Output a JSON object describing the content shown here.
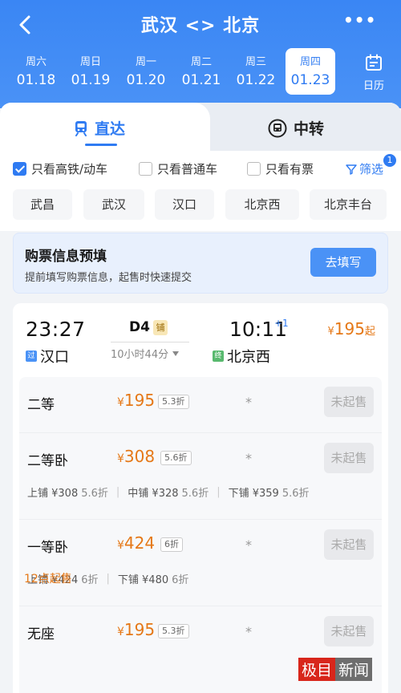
{
  "header": {
    "title": "武汉 <> 北京",
    "dates": [
      {
        "weekday": "周六",
        "date": "01.18"
      },
      {
        "weekday": "周日",
        "date": "01.19"
      },
      {
        "weekday": "周一",
        "date": "01.20"
      },
      {
        "weekday": "周二",
        "date": "01.21"
      },
      {
        "weekday": "周三",
        "date": "01.22"
      },
      {
        "weekday": "周四",
        "date": "01.23"
      }
    ],
    "calendar_label": "日历"
  },
  "tabs": {
    "direct": "直达",
    "transfer": "中转"
  },
  "filters": {
    "hs_only": "只看高铁/动车",
    "normal_only": "只看普通车",
    "available_only": "只看有票",
    "filter_label": "筛选",
    "filter_count": "1"
  },
  "stations": [
    "武昌",
    "武汉",
    "汉口",
    "北京西",
    "北京丰台"
  ],
  "prefill": {
    "title": "购票信息预填",
    "subtitle": "提前填写购票信息，起售时快速提交",
    "button": "去填写"
  },
  "train": {
    "dep_time": "23:27",
    "arr_time": "10:11",
    "plus_day": "+1",
    "number": "D4",
    "sleeper_tag": "铺",
    "duration": "10小时44分",
    "from_tag": "过",
    "from": "汉口",
    "to_tag": "终",
    "to": "北京西",
    "min_price_yen": "¥",
    "min_price": "195",
    "min_price_suffix": "起",
    "seats": [
      {
        "name": "二等",
        "yen": "¥",
        "price": "195",
        "discount": "5.3折",
        "availability": "*",
        "status": "未起售"
      },
      {
        "name": "二等卧",
        "yen": "¥",
        "price": "308",
        "discount": "5.6折",
        "availability": "*",
        "status": "未起售",
        "berths": [
          {
            "label": "上铺 ¥308",
            "disc": "5.6折"
          },
          {
            "label": "中铺 ¥328",
            "disc": "5.6折"
          },
          {
            "label": "下铺 ¥359",
            "disc": "5.6折"
          }
        ]
      },
      {
        "name": "一等卧",
        "yen": "¥",
        "price": "424",
        "discount": "6折",
        "availability": "*",
        "status": "未起售",
        "berths": [
          {
            "label": "上铺 ¥424",
            "disc": "6折"
          },
          {
            "label": "下铺 ¥480",
            "disc": "6折"
          }
        ]
      },
      {
        "name": "无座",
        "yen": "¥",
        "price": "195",
        "discount": "5.3折",
        "availability": "*",
        "status": "未起售"
      }
    ],
    "sale_time": "12点起售"
  },
  "watermark": {
    "part1": "极目",
    "part2": "新闻"
  },
  "colors": {
    "primary": "#2f7bf2",
    "price": "#e57817",
    "header": "#3a86f4"
  }
}
